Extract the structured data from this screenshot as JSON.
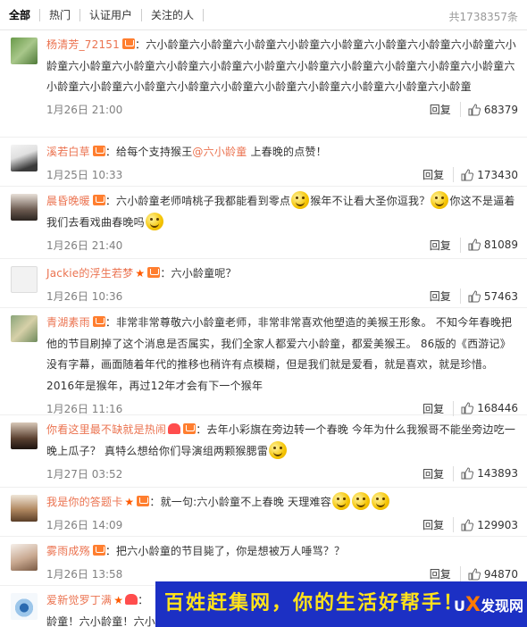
{
  "tabs": [
    {
      "label": "全部"
    },
    {
      "label": "热门"
    },
    {
      "label": "认证用户"
    },
    {
      "label": "关注的人"
    }
  ],
  "total": "共1738357条",
  "reply_label": "回复",
  "comments": [
    {
      "user": "杨清芳_72151",
      "sep": "：",
      "text": "六小龄童六小龄童六小龄童六小龄童六小龄童六小龄童六小龄童六小龄童六小龄童六小龄童六小龄童六小龄童六小龄童六小龄童六小龄童六小龄童六小龄童六小龄童六小龄童六小龄童六小龄童六小龄童六小龄童六小龄童六小龄童六小龄童六小龄童六小龄童六小龄童",
      "time": "1月26日 21:00",
      "likes": "68379"
    },
    {
      "user": "溪若白草",
      "sep": "：",
      "text_a": "给每个支持猴王",
      "mention": "@六小龄童",
      "text_b": " 上春晚的点赞！",
      "time": "1月25日 10:33",
      "likes": "173430"
    },
    {
      "user": "晨昏晚暖",
      "sep": "：",
      "text_a": "六小龄童老师啃桃子我都能看到零点",
      "text_b": "猴年不让看大圣你逗我？",
      "text_c": "你这不是逼着我们去看戏曲春晚吗",
      "time": "1月26日 21:40",
      "likes": "81089"
    },
    {
      "user": "Jackie的浮生若梦",
      "sep": "：",
      "text": "六小龄童呢？",
      "time": "1月26日 10:36",
      "likes": "57463"
    },
    {
      "user": "青湖素雨",
      "sep": "：",
      "text": "非常非常尊敬六小龄童老师，非常非常喜欢他塑造的美猴王形象。 不知今年春晚把他的节目刷掉了这个消息是否属实，我们全家人都爱六小龄童，都爱美猴王。 86版的《西游记》没有字幕，画面随着年代的推移也稍许有点模糊，但是我们就是爱看，就是喜欢，就是珍惜。 2016年是猴年，再过12年才会有下一个猴年",
      "time": "1月26日 11:16",
      "likes": "168446"
    },
    {
      "user": "你看这里最不缺就是热闹",
      "sep": "：",
      "text_a": "去年小彩旗在旁边转一个春晚 今年为什么我猴哥不能坐旁边吃一晚上瓜子？ 真特么想给你们导演组两颗猴腮雷",
      "time": "1月27日 03:52",
      "likes": "143893"
    },
    {
      "user": "我是你的答题卡",
      "sep": "：",
      "text_a": "就一句:六小龄童不上春晚 天理难容",
      "time": "1月26日 14:09",
      "likes": "129903"
    },
    {
      "user": "雾雨成殇",
      "sep": "：",
      "text": "把六小龄童的节目毙了，你是想被万人唾骂？？",
      "time": "1月26日 13:58",
      "likes": "94870"
    },
    {
      "user": "爱新觉罗丁满",
      "sep": "：",
      "text": "龄童！六小龄童！六小",
      "time": "",
      "likes": ""
    }
  ],
  "banner": {
    "text": "百姓赶集网，你的生活好帮手！",
    "logo_a": "U",
    "logo_x": "X",
    "logo_b": "发现网"
  },
  "colors": {
    "username": "#eb7350",
    "banner_bg": "#1c30c4",
    "banner_text": "#ffe21a"
  }
}
